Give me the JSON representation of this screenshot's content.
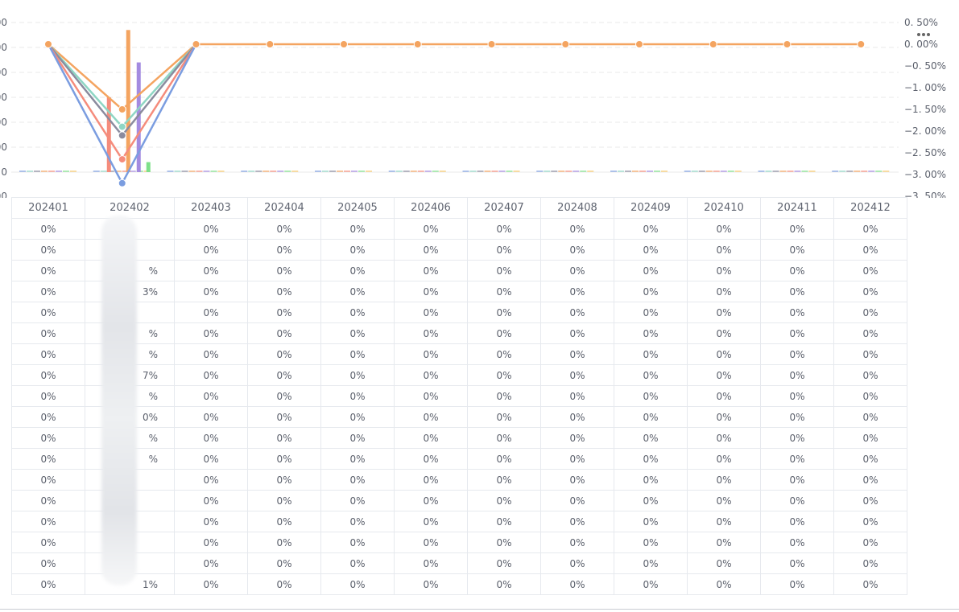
{
  "chart_data": {
    "type": "line",
    "categories": [
      "202401",
      "202402",
      "202403",
      "202404",
      "202405",
      "202406",
      "202407",
      "202408",
      "202409",
      "202410",
      "202411",
      "202412"
    ],
    "left_axis": {
      "ticks": [
        "00",
        "00",
        "00",
        "00",
        "00",
        "00",
        "0",
        "00"
      ]
    },
    "right_axis": {
      "ticks": [
        "0. 50%",
        "0. 00%",
        "−0. 50%",
        "−1. 00%",
        "−1. 50%",
        "−2. 00%",
        "−2. 50%",
        "−3. 00%",
        "−3. 50%"
      ],
      "ylim": [
        -3.5,
        0.5
      ]
    },
    "series": [
      {
        "color": "#f4a460",
        "values": [
          0,
          -1.5,
          0,
          0,
          0,
          0,
          0,
          0,
          0,
          0,
          0,
          0
        ]
      },
      {
        "color": "#8fd6c4",
        "values": [
          0,
          -1.9,
          0,
          null,
          null,
          null,
          null,
          null,
          null,
          null,
          null,
          null
        ]
      },
      {
        "color": "#8b8b9e",
        "values": [
          0,
          -2.1,
          0,
          null,
          null,
          null,
          null,
          null,
          null,
          null,
          null,
          null
        ]
      },
      {
        "color": "#f58c7c",
        "values": [
          0,
          -2.65,
          0,
          null,
          null,
          null,
          null,
          null,
          null,
          null,
          null,
          null
        ]
      },
      {
        "color": "#7b9de0",
        "values": [
          0,
          -3.2,
          0,
          null,
          null,
          null,
          null,
          null,
          null,
          null,
          null,
          null
        ]
      }
    ],
    "bars": [
      {
        "category": "202402",
        "color": "#f58c7c",
        "value": 3
      },
      {
        "category": "202402",
        "color": "#f4a460",
        "value": 5.7
      },
      {
        "category": "202402",
        "color": "#a48be0",
        "value": 4.4
      },
      {
        "category": "202402",
        "color": "#7ee08a",
        "value": 0.4
      }
    ],
    "grid": true
  },
  "ui": {
    "more_icon": "more-icon"
  },
  "table": {
    "header": [
      "202401",
      "202402",
      "202403",
      "202404",
      "202405",
      "202406",
      "202407",
      "202408",
      "202409",
      "202410",
      "202411",
      "202412"
    ],
    "row_count": 18,
    "cell_value": "0%",
    "col2_fragments": [
      "",
      "",
      "%",
      "3%",
      "",
      "%",
      "%",
      "7%",
      "%",
      "0%",
      "%",
      "%",
      "",
      "",
      "",
      "",
      "",
      "1%"
    ]
  }
}
